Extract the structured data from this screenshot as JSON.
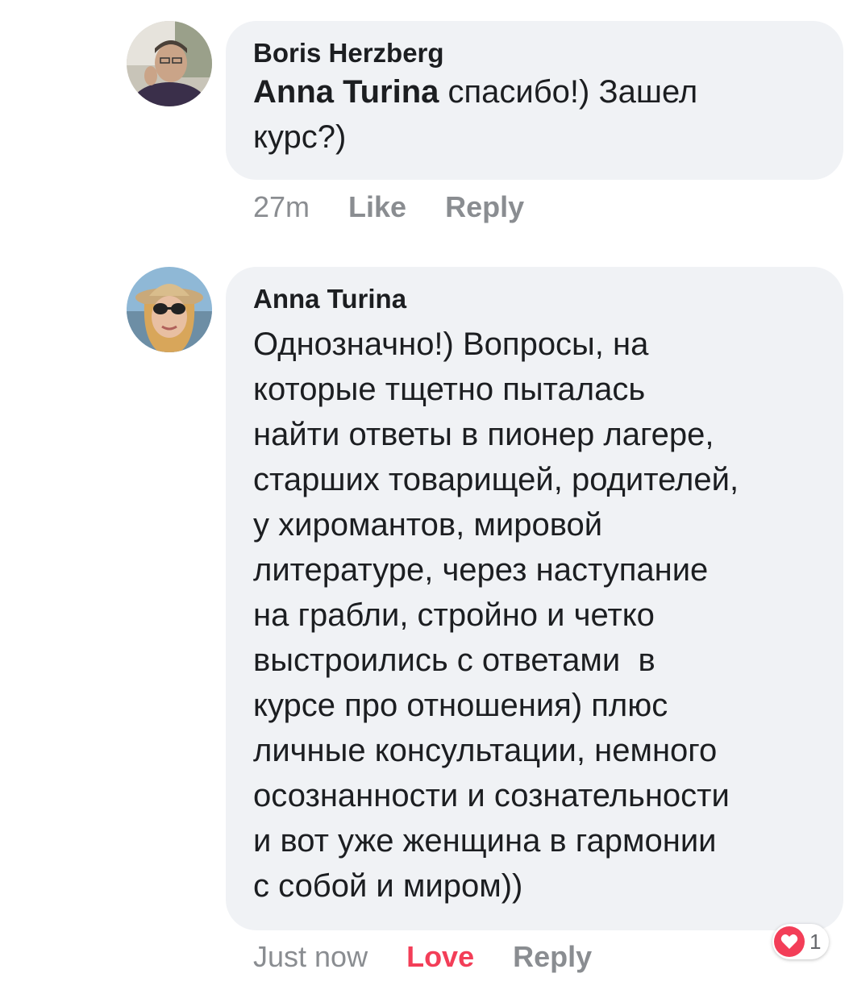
{
  "comments": [
    {
      "author": "Boris Herzberg",
      "mention": "Anna Turina",
      "text": " спасибо!) Зашел\nкурс?)",
      "time": "27m",
      "like_label": "Like",
      "reply_label": "Reply"
    },
    {
      "author": "Anna Turina",
      "text": "Однозначно!) Вопросы, на\nкоторые тщетно пыталась\nнайти ответы в пионер лагере,\nстарших товарищей, родителей,\nу хиромантов, мировой\nлитературе, через наступание\nна грабли, стройно и четко\nвыстроились с ответами  в\nкурсе про отношения) плюс\nличные консультации, немного\nосознанности и сознательности\nи вот уже женщина в гармонии\nс собой и миром))",
      "time": "Just now",
      "love_label": "Love",
      "reply_label": "Reply",
      "reaction": {
        "icon": "heart-icon",
        "count": "1",
        "color": "#f33e58"
      }
    }
  ],
  "colors": {
    "bubble": "#f0f2f5",
    "meta": "#8a8d91",
    "love": "#f33e58",
    "text": "#1c1e21"
  }
}
